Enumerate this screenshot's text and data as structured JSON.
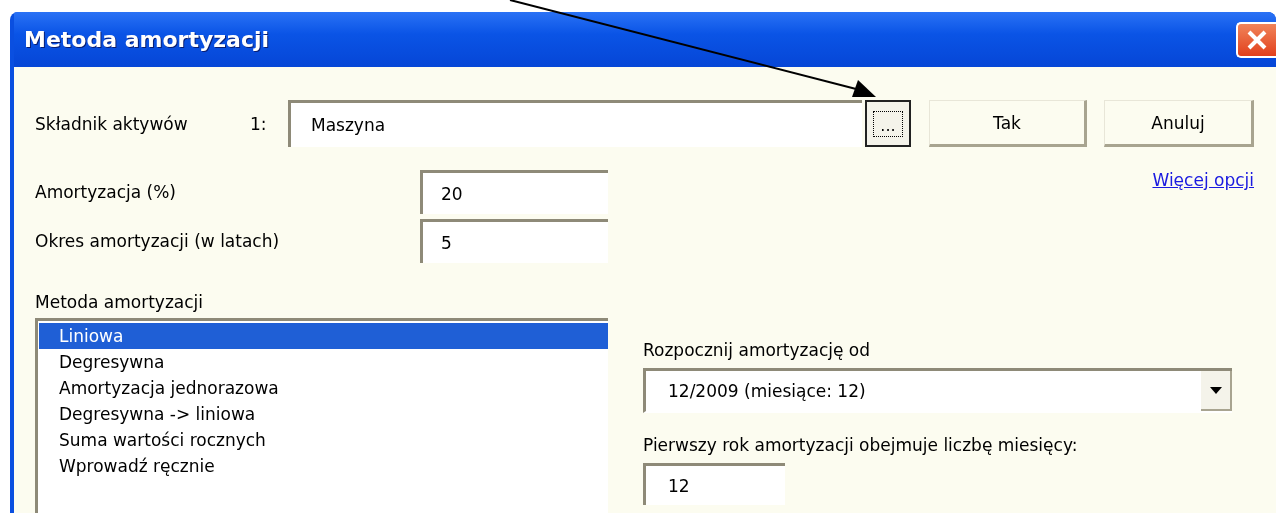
{
  "window": {
    "title": "Metoda amortyzacji"
  },
  "asset": {
    "label": "Składnik aktywów",
    "index": "1:",
    "value": "Maszyna",
    "browse": "..."
  },
  "buttons": [
    "Tak",
    "Anuluj"
  ],
  "more_link": "Więcej opcji",
  "fields": [
    {
      "label": "Amortyzacja (%)",
      "value": "20"
    },
    {
      "label": "Okres amortyzacji (w latach)",
      "value": "5"
    }
  ],
  "method_list": {
    "label": "Metoda amortyzacji",
    "items": [
      {
        "label": "Liniowa",
        "selected": true
      },
      {
        "label": "Degresywna",
        "selected": false
      },
      {
        "label": "Amortyzacja jednorazowa",
        "selected": false
      },
      {
        "label": "Degresywna -> liniowa",
        "selected": false
      },
      {
        "label": "Suma wartości rocznych",
        "selected": false
      },
      {
        "label": "Wprowadź ręcznie",
        "selected": false
      }
    ]
  },
  "start": {
    "label": "Rozpocznij amortyzację od",
    "value": "12/2009 (miesiące: 12)"
  },
  "first_year": {
    "label": "Pierwszy rok amortyzacji obejmuje liczbę miesięcy:",
    "value": "12"
  }
}
